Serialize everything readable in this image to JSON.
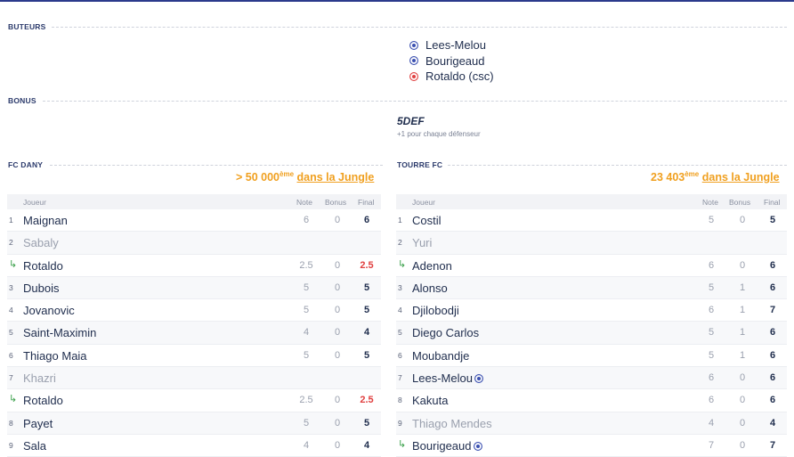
{
  "sections": {
    "buteurs": "BUTEURS",
    "bonus": "BONUS",
    "team_left": "FC DANY",
    "team_right": "TOURRE FC"
  },
  "scorers": [
    {
      "name": "Lees-Melou",
      "type": "blue"
    },
    {
      "name": "Bourigeaud",
      "type": "blue"
    },
    {
      "name": "Rotaldo (csc)",
      "type": "red"
    }
  ],
  "bonus": {
    "title": "5DEF",
    "desc": "+1 pour chaque défenseur"
  },
  "left_rank": {
    "value": "> 50 000",
    "sup": "ème",
    "link": "dans la Jungle"
  },
  "right_rank": {
    "value": "23 403",
    "sup": "ème",
    "link": "dans la Jungle"
  },
  "headers": {
    "player": "Joueur",
    "note": "Note",
    "bonus": "Bonus",
    "final": "Final"
  },
  "left_rows": [
    {
      "num": "1",
      "name": "Maignan",
      "note": "6",
      "bonus": "0",
      "final": "6"
    },
    {
      "num": "2",
      "name": "Sabaly",
      "note": "",
      "bonus": "",
      "final": "",
      "dim": true
    },
    {
      "num": "↳",
      "sub": true,
      "name": "Rotaldo",
      "note": "2.5",
      "bonus": "0",
      "final": "2.5",
      "red": true
    },
    {
      "num": "3",
      "name": "Dubois",
      "note": "5",
      "bonus": "0",
      "final": "5"
    },
    {
      "num": "4",
      "name": "Jovanovic",
      "note": "5",
      "bonus": "0",
      "final": "5"
    },
    {
      "num": "5",
      "name": "Saint-Maximin",
      "note": "4",
      "bonus": "0",
      "final": "4"
    },
    {
      "num": "6",
      "name": "Thiago Maia",
      "note": "5",
      "bonus": "0",
      "final": "5"
    },
    {
      "num": "7",
      "name": "Khazri",
      "note": "",
      "bonus": "",
      "final": "",
      "dim": true
    },
    {
      "num": "↳",
      "sub": true,
      "name": "Rotaldo",
      "note": "2.5",
      "bonus": "0",
      "final": "2.5",
      "red": true
    },
    {
      "num": "8",
      "name": "Payet",
      "note": "5",
      "bonus": "0",
      "final": "5"
    },
    {
      "num": "9",
      "name": "Sala",
      "note": "4",
      "bonus": "0",
      "final": "4"
    }
  ],
  "right_rows": [
    {
      "num": "1",
      "name": "Costil",
      "note": "5",
      "bonus": "0",
      "final": "5"
    },
    {
      "num": "2",
      "name": "Yuri",
      "note": "",
      "bonus": "",
      "final": "",
      "dim": true
    },
    {
      "num": "↳",
      "sub": true,
      "name": "Adenon",
      "note": "6",
      "bonus": "0",
      "final": "6"
    },
    {
      "num": "3",
      "name": "Alonso",
      "note": "5",
      "bonus": "1",
      "final": "6"
    },
    {
      "num": "4",
      "name": "Djilobodji",
      "note": "6",
      "bonus": "1",
      "final": "7"
    },
    {
      "num": "5",
      "name": "Diego Carlos",
      "note": "5",
      "bonus": "1",
      "final": "6"
    },
    {
      "num": "6",
      "name": "Moubandje",
      "note": "5",
      "bonus": "1",
      "final": "6"
    },
    {
      "num": "7",
      "name": "Lees-Melou",
      "note": "6",
      "bonus": "0",
      "final": "6",
      "ball": true
    },
    {
      "num": "8",
      "name": "Kakuta",
      "note": "6",
      "bonus": "0",
      "final": "6"
    },
    {
      "num": "9",
      "name": "Thiago Mendes",
      "note": "4",
      "bonus": "0",
      "final": "4",
      "dim": true
    },
    {
      "num": "↳",
      "sub": true,
      "name": "Bourigeaud",
      "note": "7",
      "bonus": "0",
      "final": "7",
      "ball": true
    }
  ],
  "colors": {
    "accent": "#f0a020",
    "ball_blue": "#3a4fb0",
    "ball_red": "#e04040",
    "sub_green": "#3aa04a"
  },
  "icons": {
    "goal": "soccer-ball-icon",
    "own_goal": "soccer-ball-own-goal-icon",
    "substitution": "substitution-arrow-icon"
  }
}
